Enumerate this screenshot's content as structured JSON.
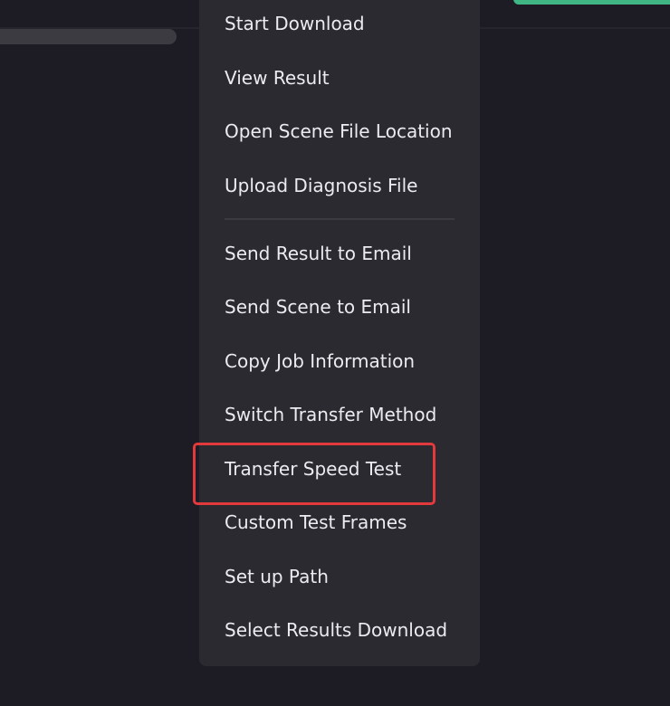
{
  "context_menu": {
    "items": [
      {
        "label": "Start Download"
      },
      {
        "label": "View Result"
      },
      {
        "label": "Open Scene File Location"
      },
      {
        "label": "Upload Diagnosis File"
      },
      {
        "label": "Send Result to Email"
      },
      {
        "label": "Send Scene to Email"
      },
      {
        "label": "Copy Job Information"
      },
      {
        "label": "Switch Transfer Method"
      },
      {
        "label": "Transfer Speed Test"
      },
      {
        "label": "Custom Test Frames"
      },
      {
        "label": "Set up Path"
      },
      {
        "label": "Select Results Download"
      }
    ],
    "highlighted_item": "Transfer Speed Test"
  },
  "colors": {
    "background": "#1d1c24",
    "menu_background": "#2b2a31",
    "menu_text": "#ecebef",
    "highlight_border": "#e2393c",
    "status_accent": "#3fb684"
  }
}
